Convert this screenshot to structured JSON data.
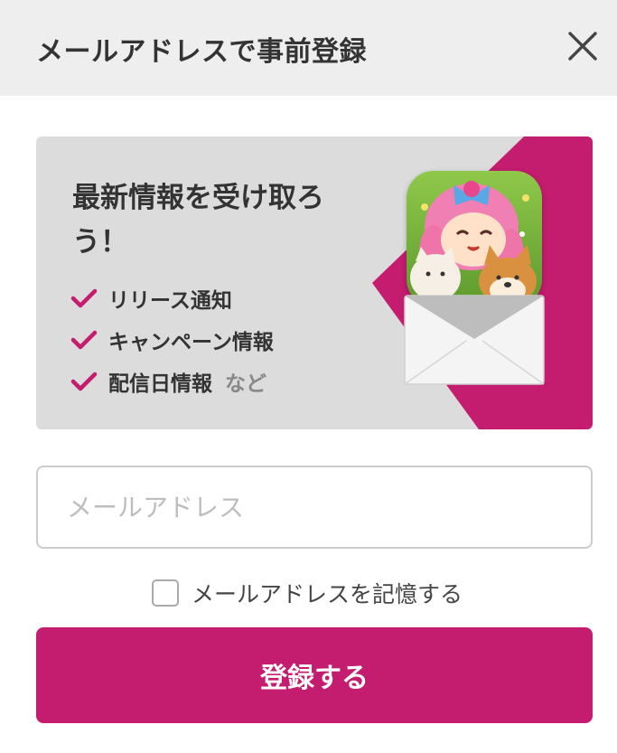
{
  "header": {
    "title": "メールアドレスで事前登録",
    "close_icon": "close-icon"
  },
  "banner": {
    "headline": "最新情報を受け取ろう！",
    "features": [
      {
        "label": "リリース通知",
        "suffix": ""
      },
      {
        "label": "キャンペーン情報",
        "suffix": ""
      },
      {
        "label": "配信日情報",
        "suffix": "など"
      }
    ],
    "check_icon": "check-icon",
    "app_icon": "app-icon",
    "envelope_icon": "envelope-icon"
  },
  "form": {
    "email_placeholder": "メールアドレス",
    "email_value": "",
    "remember_label": "メールアドレスを記憶する",
    "remember_checked": false,
    "submit_label": "登録する"
  },
  "colors": {
    "accent": "#c41c6e",
    "header_bg": "#eeeeee",
    "banner_bg": "#dcdcdc",
    "text": "#333333"
  }
}
